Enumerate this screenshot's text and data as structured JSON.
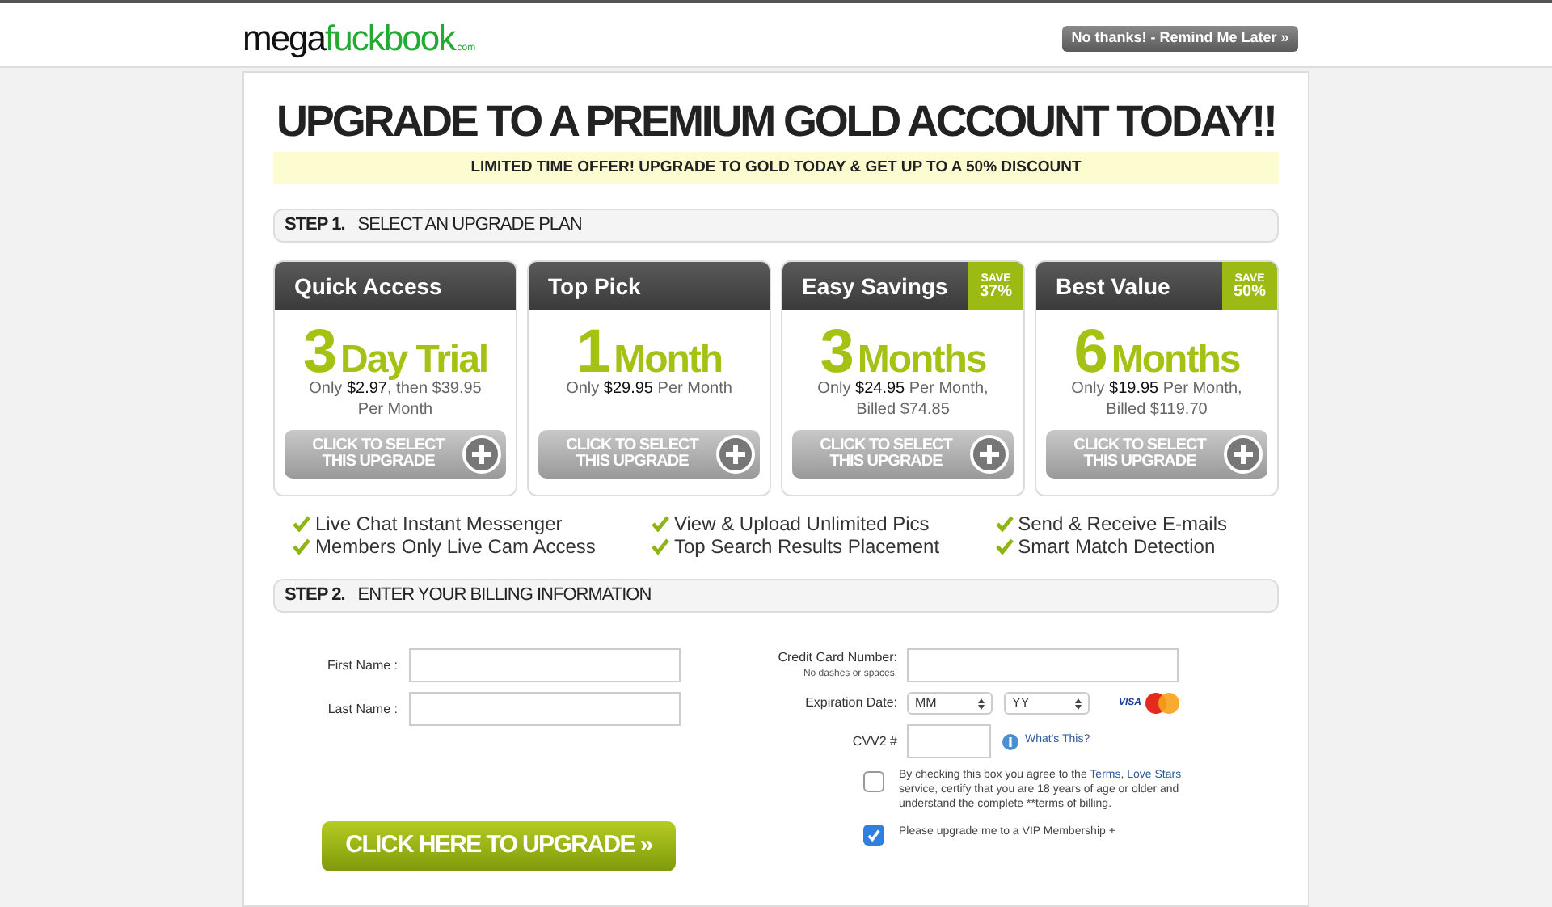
{
  "header": {
    "logo": {
      "first": "mega",
      "second": "fuckbook",
      "suffix": ".com"
    },
    "dismiss_button": "No thanks! - Remind Me Later »"
  },
  "title": "UPGRADE TO A PREMIUM GOLD ACCOUNT TODAY!!",
  "offer_banner": "LIMITED TIME OFFER! UPGRADE TO GOLD TODAY & GET UP TO A 50% DISCOUNT",
  "step1": {
    "number": "STEP 1.",
    "label": "SELECT AN UPGRADE PLAN"
  },
  "plans": [
    {
      "name": "Quick Access",
      "count": "3",
      "unit": "Day Trial",
      "price": "Only **$2.97**, then $39.95 Per Month",
      "button": "CLICK TO SELECT THIS UPGRADE"
    },
    {
      "name": "Top Pick",
      "count": "1",
      "unit": "Month",
      "price": "Only **$29.95** Per Month",
      "button": "CLICK TO SELECT THIS UPGRADE"
    },
    {
      "name": "Easy Savings",
      "save_label": "SAVE",
      "save": "37%",
      "count": "3",
      "unit": "Months",
      "price": "Only **$24.95** Per Month, Billed $74.85",
      "button": "CLICK TO SELECT THIS UPGRADE"
    },
    {
      "name": "Best Value",
      "save_label": "SAVE",
      "save": "50%",
      "count": "6",
      "unit": "Months",
      "price": "Only **$19.95** Per Month, Billed $119.70",
      "button": "CLICK TO SELECT THIS UPGRADE"
    }
  ],
  "features": [
    [
      "Live Chat Instant Messenger",
      "Members Only Live Cam Access"
    ],
    [
      "View & Upload Unlimited Pics",
      "Top Search Results Placement"
    ],
    [
      "Send & Receive E-mails",
      "Smart Match Detection"
    ]
  ],
  "step2": {
    "number": "STEP 2.",
    "label": "ENTER YOUR BILLING INFORMATION"
  },
  "billing": {
    "first_name": "First Name :",
    "last_name": "Last Name :",
    "card_number": "Credit Card Number:",
    "card_hint": "No dashes or spaces.",
    "expiration": "Expiration Date:",
    "month": "MM",
    "year": "YY",
    "visa": "VISA",
    "cvv": "CVV2 #",
    "whats_this": "What's This?",
    "agree": {
      "checked": false,
      "parts": [
        {
          "text": "By checking this box you agree to the ",
          "link": false
        },
        {
          "text": "Terms",
          "link": true
        },
        {
          "text": ", ",
          "link": false
        },
        {
          "text": "Love Stars",
          "link": true
        },
        {
          "text": " service, certify that you are 18 years of age or older and understand the complete **terms of billing.",
          "link": false
        }
      ]
    },
    "vip": {
      "checked": true,
      "label": "Please upgrade me to a VIP Membership +"
    }
  },
  "upgrade_button": "CLICK HERE TO UPGRADE »"
}
